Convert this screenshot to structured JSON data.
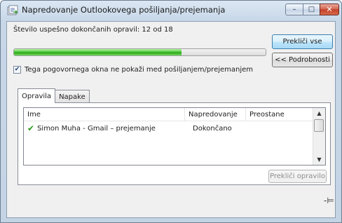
{
  "window": {
    "title": "Napredovanje Outlookovega pošiljanja/prejemanja",
    "app_icon": "send-receive-icon",
    "controls": {
      "minimize": "–",
      "maximize": "□",
      "close": "✕"
    }
  },
  "status": {
    "completed_text": "Število uspešno dokončanih opravil: 12 od 18",
    "progress_fraction": 0.6667
  },
  "checkbox": {
    "checked": true,
    "label": "Tega pogovornega okna ne pokaži med pošiljanjem/prejemanjem"
  },
  "buttons": {
    "cancel_all": "Prekliči vse",
    "details": "<< Podrobnosti",
    "cancel_task": "Prekliči opravilo"
  },
  "tabs": [
    {
      "label": "Opravila",
      "active": true
    },
    {
      "label": "Napake",
      "active": false
    }
  ],
  "table": {
    "columns": [
      "Ime",
      "Napredovanje",
      "Preostane"
    ],
    "rows": [
      {
        "status_icon": "checkmark-icon",
        "name": "Simon Muha - Gmail – prejemanje",
        "progress": "Dokončano",
        "remaining": ""
      }
    ]
  },
  "icons": {
    "pin": "pin-icon"
  },
  "colors": {
    "progress": "#3cb82a",
    "check": "#2b9a1e"
  }
}
